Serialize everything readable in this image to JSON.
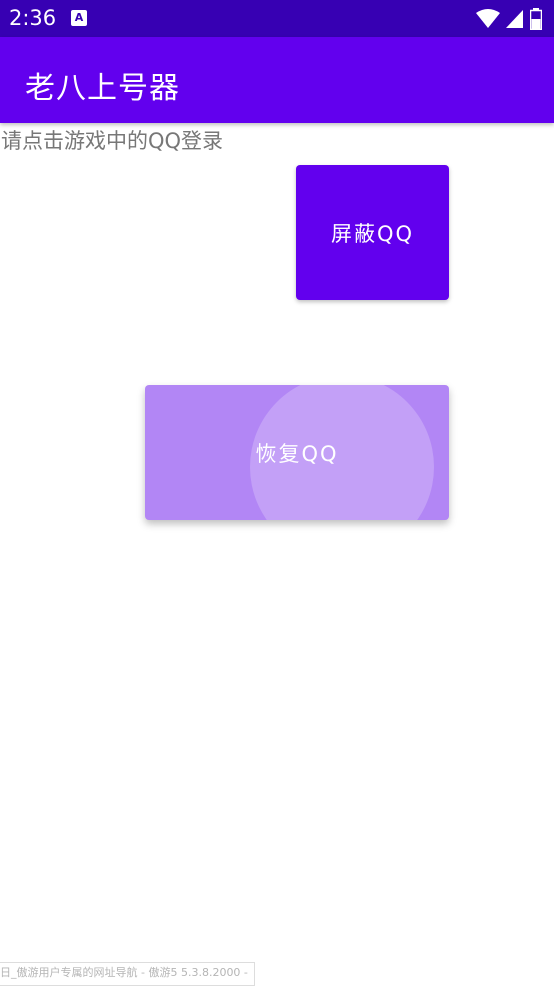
{
  "status_bar": {
    "time": "2:36",
    "notification_icon_letter": "A",
    "icons": [
      "wifi-icon",
      "signal-icon",
      "battery-icon"
    ]
  },
  "app_bar": {
    "title": "老八上号器"
  },
  "main": {
    "instruction": "请点击游戏中的QQ登录",
    "block_button": "屏蔽QQ",
    "restore_button": "恢复QQ"
  },
  "bottom_bar": {
    "text": "日_傲游用户专属的网址导航 - 傲游5 5.3.8.2000 -"
  },
  "colors": {
    "status_bar": "#3700b3",
    "app_bar": "#6200ee",
    "primary_button": "#6200ee",
    "pressed_button": "#b286f5"
  }
}
